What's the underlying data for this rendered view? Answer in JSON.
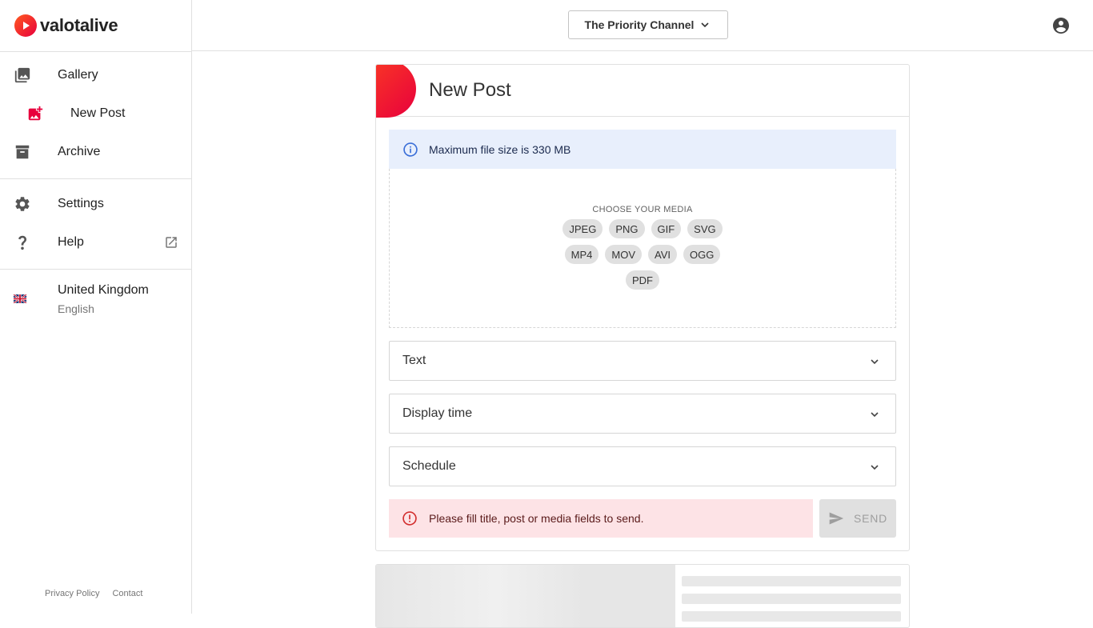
{
  "brand": {
    "name": "valotalive",
    "accent": "#e8003d"
  },
  "sidebar": {
    "items": [
      {
        "label": "Gallery",
        "icon": "gallery-icon"
      },
      {
        "label": "New Post",
        "icon": "add-photo-icon"
      },
      {
        "label": "Archive",
        "icon": "archive-icon"
      },
      {
        "label": "Settings",
        "icon": "gear-icon"
      },
      {
        "label": "Help",
        "icon": "help-icon"
      }
    ],
    "language": {
      "country": "United Kingdom",
      "language": "English",
      "flag": "uk-flag-icon"
    },
    "footer": {
      "privacy": "Privacy Policy",
      "contact": "Contact"
    }
  },
  "header": {
    "channel": "The Priority Channel"
  },
  "post": {
    "title": "New Post",
    "info": "Maximum file size is 330 MB",
    "media": {
      "label": "CHOOSE YOUR MEDIA",
      "formats": [
        "JPEG",
        "PNG",
        "GIF",
        "SVG",
        "MP4",
        "MOV",
        "AVI",
        "OGG",
        "PDF"
      ]
    },
    "sections": {
      "text": "Text",
      "display_time": "Display time",
      "schedule": "Schedule"
    },
    "error": "Please fill title, post or media fields to send.",
    "send": "SEND"
  },
  "colors": {
    "info_bg": "#e8effc",
    "error_bg": "#fde3e6",
    "error_icon": "#d32f2f",
    "info_icon": "#3b6fd8"
  }
}
